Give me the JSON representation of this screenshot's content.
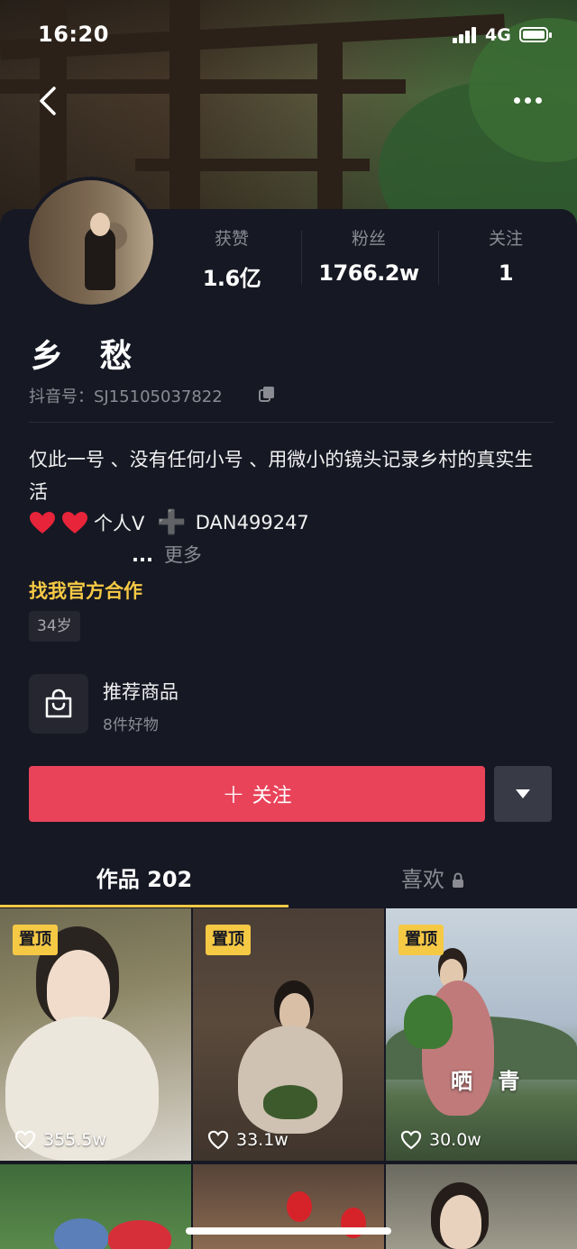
{
  "status_bar": {
    "time": "16:20",
    "network": "4G"
  },
  "stats": [
    {
      "label": "获赞",
      "value": "1.6亿"
    },
    {
      "label": "粉丝",
      "value": "1766.2w"
    },
    {
      "label": "关注",
      "value": "1"
    }
  ],
  "profile": {
    "nickname": "乡 愁",
    "douyin_id": "抖音号：SJ15105037822",
    "bio": "仅此一号 、没有任何小号 、用微小的镜头记录乡村的真实生活",
    "bio_personal": "个人V",
    "bio_wechat": "DAN499247",
    "more_dots": "...",
    "more_label": "更多",
    "cooperation": "找我官方合作",
    "age": "34岁"
  },
  "shop": {
    "title": "推荐商品",
    "subtitle": "8件好物"
  },
  "follow": {
    "plus": "+",
    "label": "关注"
  },
  "tabs": {
    "works": "作品 202",
    "likes": "喜欢"
  },
  "videos": [
    {
      "badge": "置顶",
      "likes": "355.5w"
    },
    {
      "badge": "置顶",
      "likes": "33.1w"
    },
    {
      "badge": "置顶",
      "likes": "30.0w",
      "caption": "晒 青"
    }
  ],
  "colors": {
    "accent_red": "#e9435a",
    "accent_yellow": "#f6c945",
    "background": "#161823"
  }
}
